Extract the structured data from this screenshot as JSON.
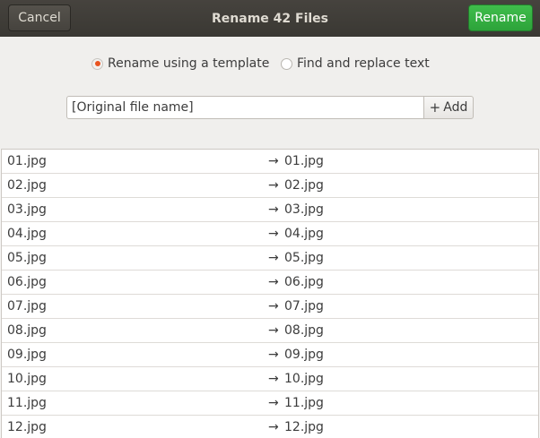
{
  "dialog": {
    "title": "Rename 42 Files",
    "cancel_label": "Cancel",
    "rename_label": "Rename"
  },
  "modes": {
    "template_label": "Rename using a template",
    "template_selected": true,
    "replace_label": "Find and replace text",
    "replace_selected": false
  },
  "template": {
    "value": "[Original file name]",
    "add_label": "Add",
    "add_icon": "plus-icon"
  },
  "arrow_glyph": "→",
  "files": [
    {
      "original": "01.jpg",
      "renamed": "01.jpg"
    },
    {
      "original": "02.jpg",
      "renamed": "02.jpg"
    },
    {
      "original": "03.jpg",
      "renamed": "03.jpg"
    },
    {
      "original": "04.jpg",
      "renamed": "04.jpg"
    },
    {
      "original": "05.jpg",
      "renamed": "05.jpg"
    },
    {
      "original": "06.jpg",
      "renamed": "06.jpg"
    },
    {
      "original": "07.jpg",
      "renamed": "07.jpg"
    },
    {
      "original": "08.jpg",
      "renamed": "08.jpg"
    },
    {
      "original": "09.jpg",
      "renamed": "09.jpg"
    },
    {
      "original": "10.jpg",
      "renamed": "10.jpg"
    },
    {
      "original": "11.jpg",
      "renamed": "11.jpg"
    },
    {
      "original": "12.jpg",
      "renamed": "12.jpg"
    }
  ],
  "colors": {
    "titlebar": "#3f3c37",
    "suggested_action": "#33a941",
    "radio_accent": "#e95420"
  }
}
